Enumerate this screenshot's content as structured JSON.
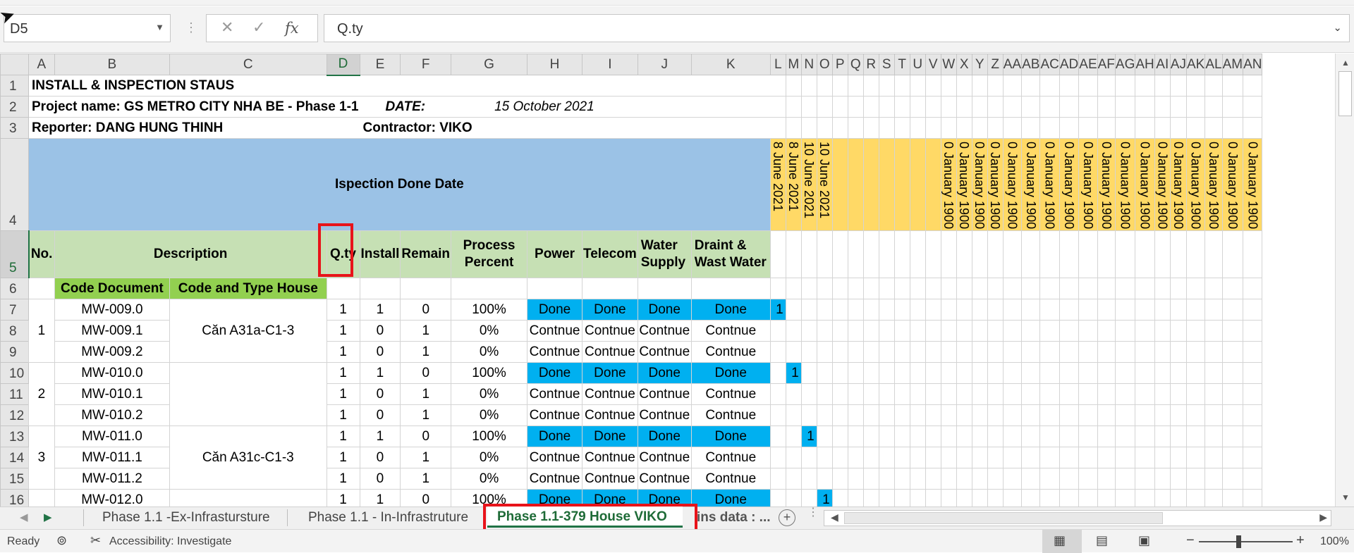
{
  "window": {
    "cursor": "arrow-cursor-icon"
  },
  "formula_bar": {
    "name_box": "D5",
    "cancel_icon": "✕",
    "enter_icon": "✓",
    "fx_label": "fx",
    "content": "Q.ty"
  },
  "sheet": {
    "columns": [
      "A",
      "B",
      "C",
      "D",
      "E",
      "F",
      "G",
      "H",
      "I",
      "J",
      "K",
      "L",
      "M",
      "N",
      "O",
      "P",
      "Q",
      "R",
      "S",
      "T",
      "U",
      "V",
      "W",
      "X",
      "Y",
      "Z",
      "AA",
      "AB",
      "AC",
      "AD",
      "AE",
      "AF",
      "AG",
      "AH",
      "AI",
      "AJ",
      "AK",
      "AL",
      "AM",
      "AN"
    ],
    "row_numbers": [
      "1",
      "2",
      "3",
      "4",
      "5",
      "6",
      "7",
      "8",
      "9",
      "10",
      "11",
      "12",
      "13",
      "14",
      "15",
      "16"
    ],
    "selected_cell": "D5",
    "title": "INSTALL & INSPECTION STAUS",
    "project": "Project name: GS METRO CITY NHA BE - Phase 1-1",
    "date_label": "DATE:",
    "date_value": "15 October 2021",
    "reporter": "Reporter: DANG HUNG THINH",
    "contractor": "Contractor: VIKO",
    "banner": "Ispection Done Date",
    "date_headers": [
      "8 June 2021",
      "8 June 2021",
      "10 June 2021",
      "10 June 2021"
    ],
    "zero_date_header": "0 January 1900",
    "zero_date_count": 18,
    "headers": {
      "no": "No.",
      "description": "Description",
      "qty": "Q.ty",
      "install": "Install",
      "remain": "Remain",
      "process_1": "Process",
      "process_2": "Percent",
      "power": "Power",
      "telecom": "Telecom",
      "water_1": "Water",
      "water_2": "Supply",
      "drain_1": "Draint &",
      "drain_2": "Wast Water"
    },
    "sub_headers": {
      "code_document": "Code Document",
      "code_type": "Code  and Type House"
    },
    "groups": [
      {
        "no": "1",
        "house": "Căn A31a-C1-3"
      },
      {
        "no": "2",
        "house": ""
      },
      {
        "no": "3",
        "house": "Căn A31c-C1-3"
      }
    ],
    "rows": [
      {
        "code": "MW-009.0",
        "qty": "1",
        "install": "1",
        "remain": "0",
        "percent": "100%",
        "power": "Done",
        "telecom": "Done",
        "water": "Done",
        "drain": "Done",
        "done": true,
        "mark": "1",
        "mark_col": 0
      },
      {
        "code": "MW-009.1",
        "qty": "1",
        "install": "0",
        "remain": "1",
        "percent": "0%",
        "power": "Contnue",
        "telecom": "Contnue",
        "water": "Contnue",
        "drain": "Contnue",
        "done": false,
        "mark": "",
        "mark_col": -1
      },
      {
        "code": "MW-009.2",
        "qty": "1",
        "install": "0",
        "remain": "1",
        "percent": "0%",
        "power": "Contnue",
        "telecom": "Contnue",
        "water": "Contnue",
        "drain": "Contnue",
        "done": false,
        "mark": "",
        "mark_col": -1
      },
      {
        "code": "MW-010.0",
        "qty": "1",
        "install": "1",
        "remain": "0",
        "percent": "100%",
        "power": "Done",
        "telecom": "Done",
        "water": "Done",
        "drain": "Done",
        "done": true,
        "mark": "1",
        "mark_col": 1
      },
      {
        "code": "MW-010.1",
        "qty": "1",
        "install": "0",
        "remain": "1",
        "percent": "0%",
        "power": "Contnue",
        "telecom": "Contnue",
        "water": "Contnue",
        "drain": "Contnue",
        "done": false,
        "mark": "",
        "mark_col": -1
      },
      {
        "code": "MW-010.2",
        "qty": "1",
        "install": "0",
        "remain": "1",
        "percent": "0%",
        "power": "Contnue",
        "telecom": "Contnue",
        "water": "Contnue",
        "drain": "Contnue",
        "done": false,
        "mark": "",
        "mark_col": -1
      },
      {
        "code": "MW-011.0",
        "qty": "1",
        "install": "1",
        "remain": "0",
        "percent": "100%",
        "power": "Done",
        "telecom": "Done",
        "water": "Done",
        "drain": "Done",
        "done": true,
        "mark": "1",
        "mark_col": 2
      },
      {
        "code": "MW-011.1",
        "qty": "1",
        "install": "0",
        "remain": "1",
        "percent": "0%",
        "power": "Contnue",
        "telecom": "Contnue",
        "water": "Contnue",
        "drain": "Contnue",
        "done": false,
        "mark": "",
        "mark_col": -1
      },
      {
        "code": "MW-011.2",
        "qty": "1",
        "install": "0",
        "remain": "1",
        "percent": "0%",
        "power": "Contnue",
        "telecom": "Contnue",
        "water": "Contnue",
        "drain": "Contnue",
        "done": false,
        "mark": "",
        "mark_col": -1
      },
      {
        "code": "MW-012.0",
        "qty": "1",
        "install": "1",
        "remain": "0",
        "percent": "100%",
        "power": "Done",
        "telecom": "Done",
        "water": "Done",
        "drain": "Done",
        "done": true,
        "mark": "1",
        "mark_col": 3
      }
    ]
  },
  "tabs": {
    "items": [
      "Phase 1.1 -Ex-Infrastursture",
      "Phase 1.1 - In-Infrastruture",
      "Phase 1.1-379 House VIKO",
      "ins data : ..."
    ],
    "active_index": 2
  },
  "status": {
    "ready": "Ready",
    "accessibility": "Accessibility: Investigate",
    "zoom_minus": "−",
    "zoom_plus": "+",
    "zoom": "100%"
  },
  "colors": {
    "banner_blue": "#9bc2e6",
    "header_green": "#c6e0b4",
    "code_green": "#92d050",
    "done_blue": "#00b0f0",
    "date_yellow": "#ffd966",
    "highlight_red": "#e8131a",
    "excel_green": "#217346"
  }
}
